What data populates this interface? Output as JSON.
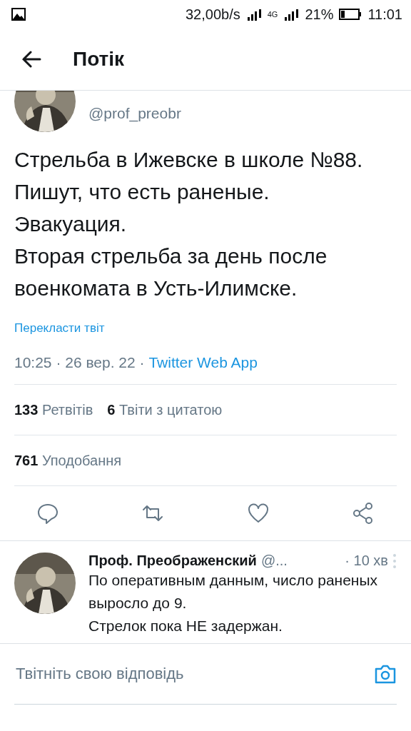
{
  "status_bar": {
    "speed": "32,00b/s",
    "network": "4G",
    "battery": "21%",
    "time": "11:01"
  },
  "header": {
    "title": "Потік"
  },
  "tweet": {
    "handle": "@prof_preobr",
    "lines": [
      "Стрельба в Ижевске в школе №88.",
      "Пишут, что есть раненые.",
      "Эвакуация.",
      "Вторая стрельба за день после военкомата в Усть-Илимске."
    ],
    "translate": "Перекласти твіт",
    "time": "10:25 · 26 вер. 22 · ",
    "source": "Twitter Web App",
    "stats": [
      {
        "count": "133",
        "label": "Ретвітів"
      },
      {
        "count": "6",
        "label": "Твіти з цитатою"
      }
    ],
    "likes": {
      "count": "761",
      "label": "Уподобання"
    }
  },
  "reply": {
    "name": "Проф. Преображенский",
    "handle": "@...",
    "time": "· 10 хв",
    "lines": [
      "По оперативным данным, число раненых выросло до 9.",
      "Стрелок пока НЕ задержан."
    ]
  },
  "compose": {
    "placeholder": "Твітніть свою відповідь"
  }
}
